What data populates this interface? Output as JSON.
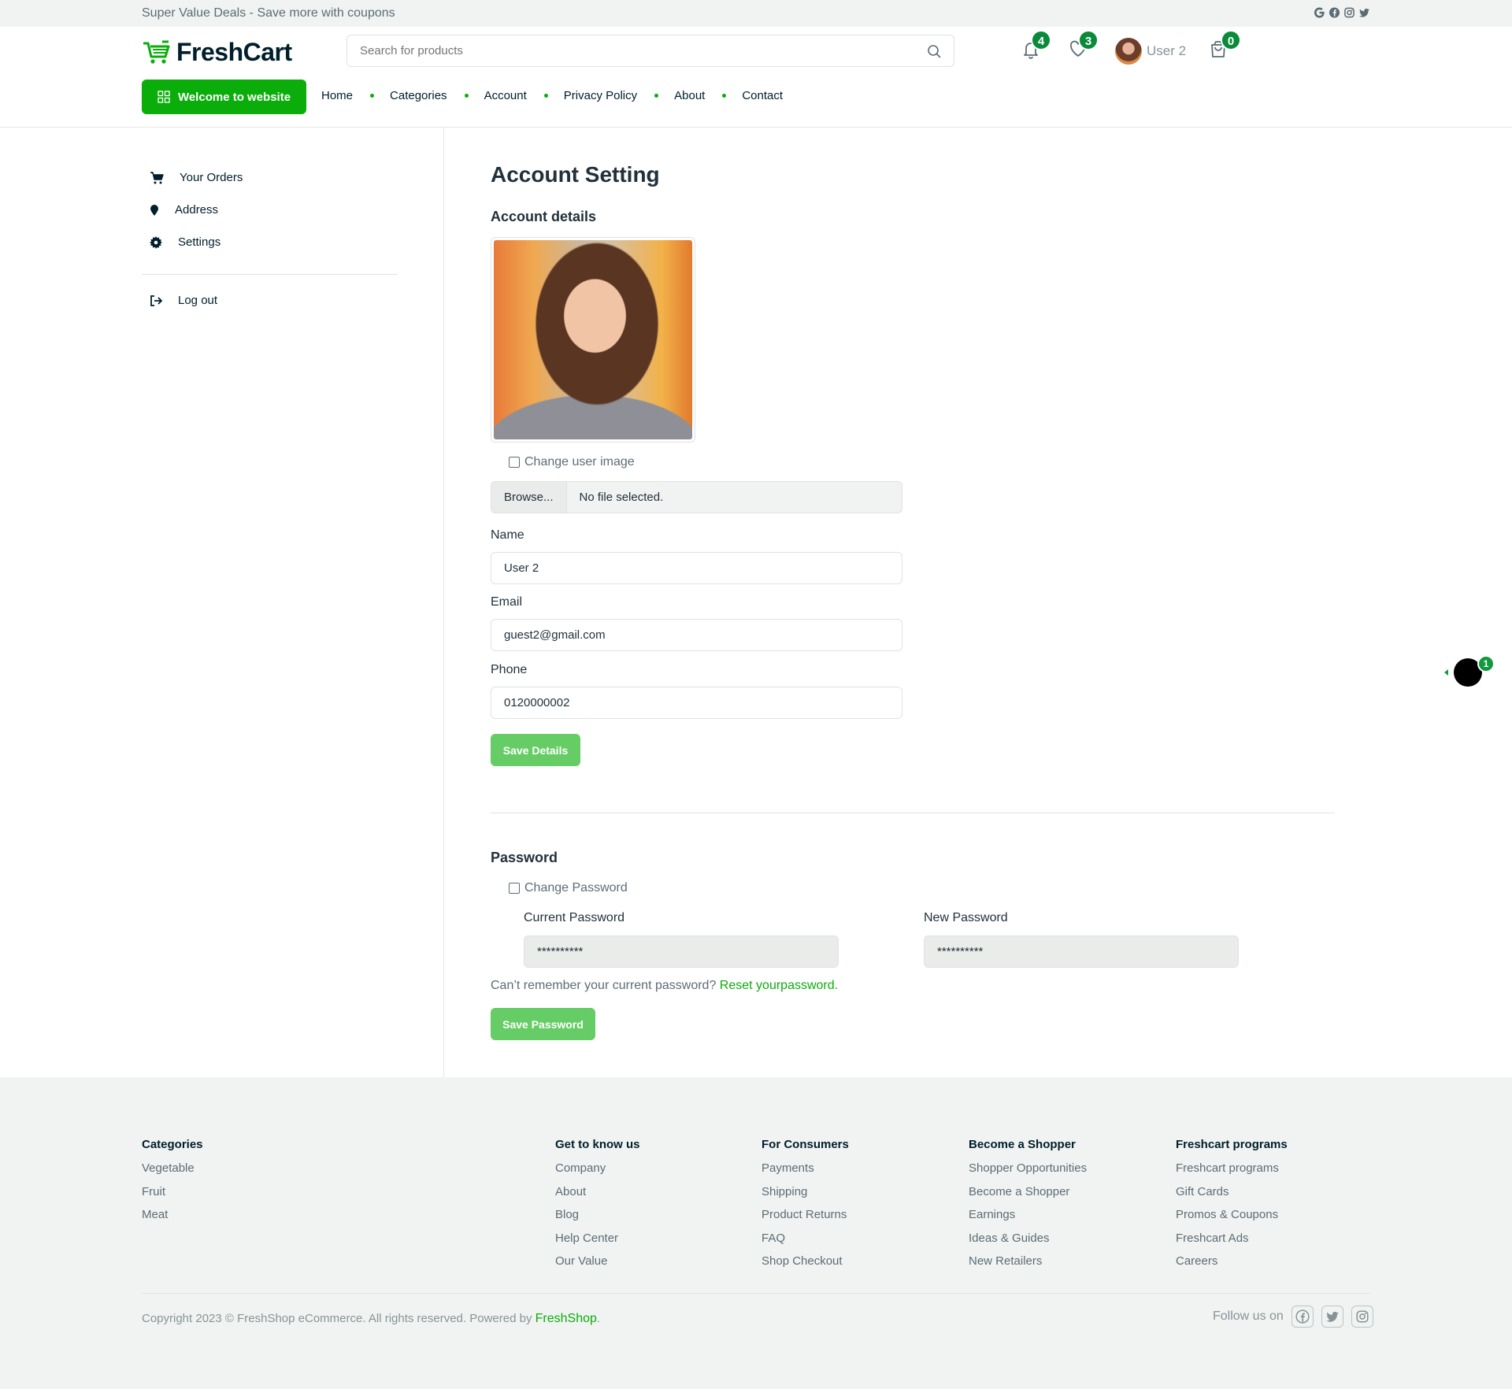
{
  "topbar": {
    "deal_text": "Super Value Deals - Save more with coupons"
  },
  "header": {
    "brand": "FreshCart",
    "search_placeholder": "Search for products",
    "notifications_count": "4",
    "wishlist_count": "3",
    "user_name": "User 2",
    "cart_count": "0"
  },
  "nav": {
    "welcome_label": "Welcome to website",
    "items": [
      "Home",
      "Categories",
      "Account",
      "Privacy Policy",
      "About",
      "Contact"
    ]
  },
  "sidebar": {
    "items": [
      "Your Orders",
      "Address",
      "Settings"
    ],
    "logout": "Log out"
  },
  "account": {
    "page_title": "Account Setting",
    "details_title": "Account details",
    "change_image_label": "Change user image",
    "browse_label": "Browse...",
    "file_status": "No file selected.",
    "name_label": "Name",
    "name_value": "User 2",
    "email_label": "Email",
    "email_value": "guest2@gmail.com",
    "phone_label": "Phone",
    "phone_value": "0120000002",
    "save_details": "Save Details"
  },
  "password": {
    "title": "Password",
    "change_label": "Change Password",
    "current_label": "Current Password",
    "current_value": "**********",
    "new_label": "New Password",
    "new_value": "**********",
    "forgot_text": "Can’t remember your current password?",
    "reset_link": "Reset yourpassword.",
    "save_label": "Save Password"
  },
  "chat": {
    "badge": "1"
  },
  "footer": {
    "columns": [
      {
        "title": "Categories",
        "links": [
          "Vegetable",
          "Fruit",
          "Meat"
        ]
      },
      {
        "title": "Get to know us",
        "links": [
          "Company",
          "About",
          "Blog",
          "Help Center",
          "Our Value"
        ]
      },
      {
        "title": "For Consumers",
        "links": [
          "Payments",
          "Shipping",
          "Product Returns",
          "FAQ",
          "Shop Checkout"
        ]
      },
      {
        "title": "Become a Shopper",
        "links": [
          "Shopper Opportunities",
          "Become a Shopper",
          "Earnings",
          "Ideas & Guides",
          "New Retailers"
        ]
      },
      {
        "title": "Freshcart programs",
        "links": [
          "Freshcart programs",
          "Gift Cards",
          "Promos & Coupons",
          "Freshcart Ads",
          "Careers"
        ]
      }
    ],
    "copyright": "Copyright 2023 © FreshShop eCommerce. All rights reserved. Powered by",
    "powered_by": "FreshShop",
    "period": ".",
    "follow_label": "Follow us on"
  },
  "colors": {
    "accent": "#0aad0a",
    "badge": "#0a8a3a",
    "button_light": "#66cc66",
    "text_dark": "#001e2b",
    "muted": "#5c6c75"
  }
}
